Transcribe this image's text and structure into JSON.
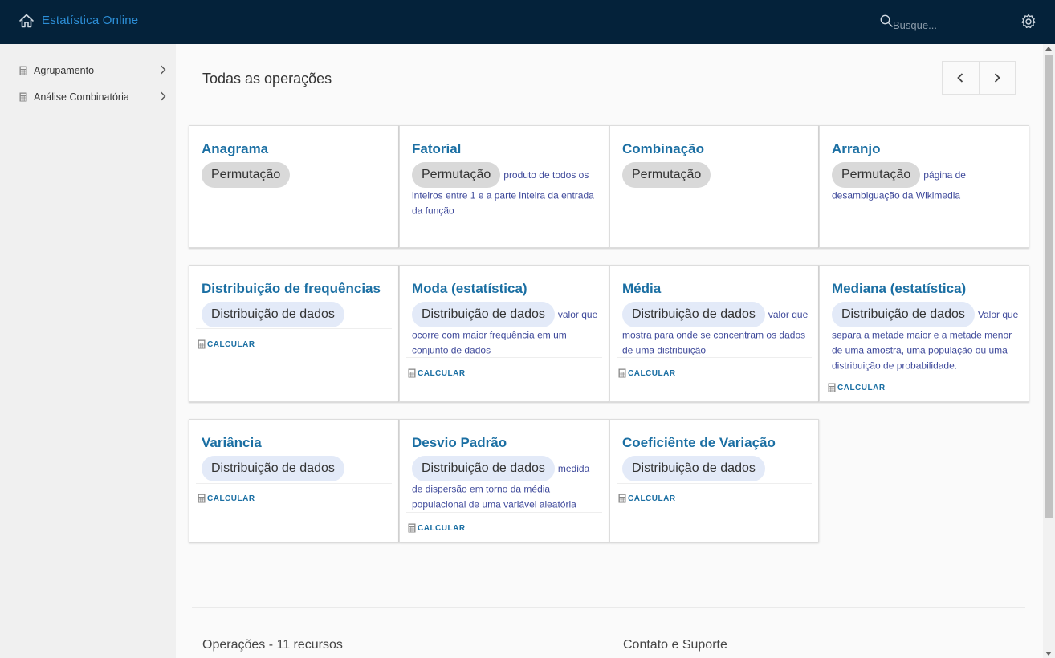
{
  "app": {
    "title": "Estatística Online",
    "search_placeholder": "Busque..."
  },
  "sidebar": {
    "items": [
      {
        "label": "Agrupamento"
      },
      {
        "label": "Análise Combinatória"
      }
    ]
  },
  "main": {
    "title": "Todas as operações",
    "calc_label": "CALCULAR",
    "cards": [
      {
        "title": "Anagrama",
        "chip": "Permutação",
        "desc": ""
      },
      {
        "title": "Fatorial",
        "chip": "Permutação",
        "desc": "produto de todos os inteiros entre 1 e a parte inteira da entrada da função"
      },
      {
        "title": "Combinação",
        "chip": "Permutação",
        "desc": ""
      },
      {
        "title": "Arranjo",
        "chip": "Permutação",
        "desc": "página de desambiguação da Wikimedia"
      },
      {
        "title": "Distribuição de frequências",
        "chip": "Distribuição de dados",
        "desc": ""
      },
      {
        "title": "Moda (estatística)",
        "chip": "Distribuição de dados",
        "desc": "valor que ocorre com maior frequência em um conjunto de dados"
      },
      {
        "title": "Média",
        "chip": "Distribuição de dados",
        "desc": "valor que mostra para onde se concentram os dados de uma distribuição"
      },
      {
        "title": "Mediana (estatística)",
        "chip": "Distribuição de dados",
        "desc": "Valor que separa a metade maior e a metade menor de uma amostra, uma população ou uma distribuição de probabilidade."
      },
      {
        "title": "Variância",
        "chip": "Distribuição de dados",
        "desc": ""
      },
      {
        "title": "Desvio Padrão",
        "chip": "Distribuição de dados",
        "desc": "medida de dispersão em torno da média populacional de uma variável aleatória"
      },
      {
        "title": "Coeficiênte de Variação",
        "chip": "Distribuição de dados",
        "desc": ""
      }
    ]
  },
  "footer": {
    "operations": "Operações - 11 recursos",
    "contact": "Contato e Suporte"
  },
  "colors": {
    "topbar": "#04223a",
    "brand": "#2c8ed6",
    "link": "#1b6fa3",
    "desc": "#3f4a9b"
  }
}
